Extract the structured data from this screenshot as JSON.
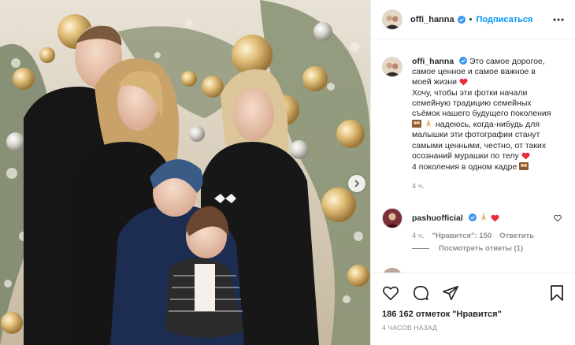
{
  "post": {
    "username": "offi_hanna",
    "follow_label": "Подписаться",
    "separator": "•"
  },
  "caption": {
    "username": "offi_hanna",
    "lines": [
      "Это самое дорогое,",
      "самое ценное и самое важное в",
      "моей жизни",
      "Хочу, чтобы эти фотки начали",
      "семейную традицию семейных",
      "съёмок нашего будущего поколения",
      "надеюсь, когда-нибудь для",
      "малышки эти фотографии станут",
      "самыми ценными, честно, от таких",
      "осознаний мурашки по телу",
      "4 поколения в одном кадре"
    ],
    "time": "4 ч."
  },
  "comment": {
    "username": "pashuofficial",
    "time": "4 ч.",
    "likes": "\"Нравится\": 150",
    "reply_label": "Ответить",
    "view_replies": "Посмотреть ответы (1)"
  },
  "actions": {
    "likes": "186 162 отметок \"Нравится\"",
    "timestamp": "4 ЧАСОВ НАЗАД"
  },
  "colors": {
    "link": "#0095f6",
    "heart": "#ed2a3c",
    "muted": "#8e8e8e",
    "verified": "#3897f0"
  }
}
